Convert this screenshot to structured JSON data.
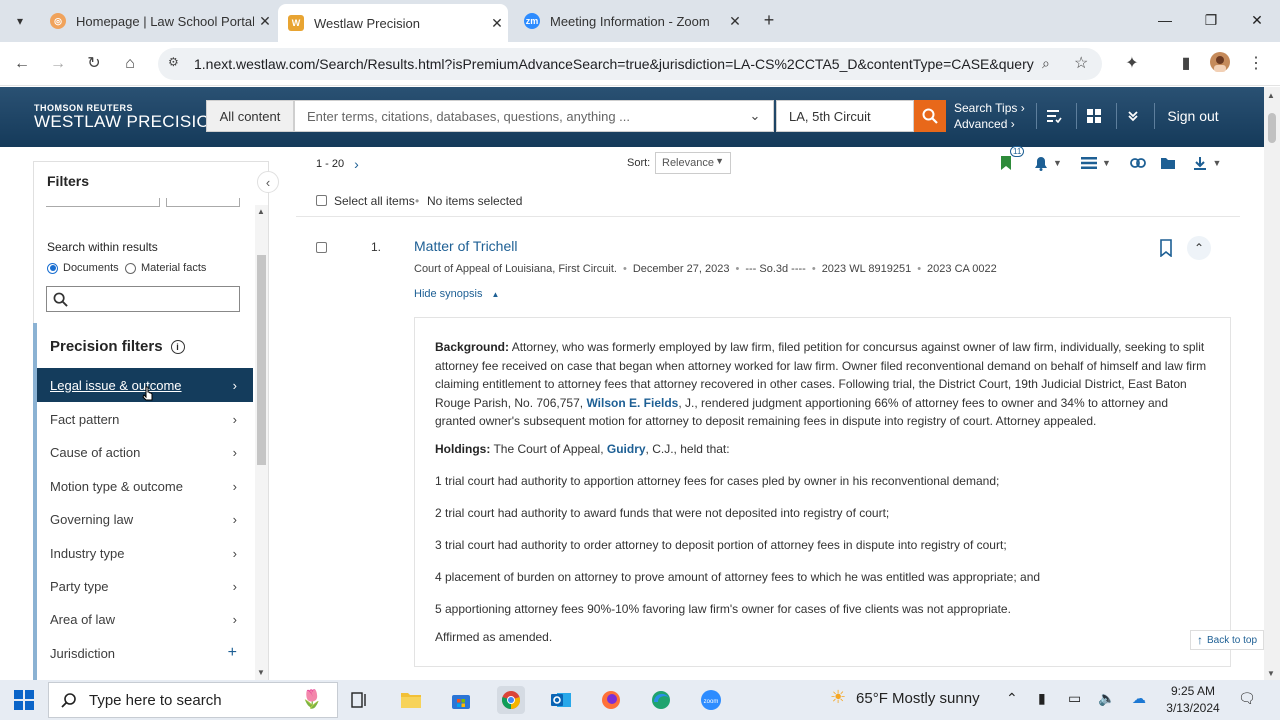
{
  "browser": {
    "tabs": [
      {
        "title": "Homepage | Law School Portal",
        "active": false
      },
      {
        "title": "Westlaw Precision",
        "active": true
      },
      {
        "title": "Meeting Information - Zoom",
        "active": false
      }
    ],
    "url": "1.next.westlaw.com/Search/Results.html?isPremiumAdvanceSearch=true&jurisdiction=LA-CS%2CCTA5_D&contentType=CASE&queryS..."
  },
  "header": {
    "brand_line1": "THOMSON REUTERS",
    "brand_line2": "WESTLAW PRECISION",
    "scope": "All content",
    "search_placeholder": "Enter terms, citations, databases, questions, anything ...",
    "jurisdiction": "LA, 5th Circuit",
    "search_tips": "Search Tips",
    "advanced": "Advanced",
    "sign_out": "Sign out"
  },
  "filters": {
    "title": "Filters",
    "search_within_label": "Search within results",
    "radio_documents": "Documents",
    "radio_material_facts": "Material facts",
    "precision_title": "Precision filters",
    "items": [
      {
        "label": "Legal issue & outcome",
        "active": true,
        "icon": "chevron-right"
      },
      {
        "label": "Fact pattern",
        "active": false,
        "icon": "chevron-right"
      },
      {
        "label": "Cause of action",
        "active": false,
        "icon": "chevron-right"
      },
      {
        "label": "Motion type & outcome",
        "active": false,
        "icon": "chevron-right"
      },
      {
        "label": "Governing law",
        "active": false,
        "icon": "chevron-right"
      },
      {
        "label": "Industry type",
        "active": false,
        "icon": "chevron-right"
      },
      {
        "label": "Party type",
        "active": false,
        "icon": "chevron-right"
      },
      {
        "label": "Area of law",
        "active": false,
        "icon": "chevron-right"
      },
      {
        "label": "Jurisdiction",
        "active": false,
        "icon": "plus"
      }
    ]
  },
  "results": {
    "range": "1 - 20",
    "sort_label": "Sort:",
    "sort_value": "Relevance",
    "folder_badge": "11",
    "select_all": "Select all items",
    "no_items": "No items selected",
    "item": {
      "number": "1.",
      "title": "Matter of Trichell",
      "court": "Court of Appeal of Louisiana, First Circuit.",
      "date": "December 27, 2023",
      "reporter": "--- So.3d ----",
      "wl_cite": "2023 WL 8919251",
      "docket": "2023 CA 0022",
      "hide_synopsis": "Hide synopsis",
      "background_label": "Background:",
      "background_part1": "Attorney, who was formerly employed by law firm, filed petition for concursus against owner of law firm, individually, seeking to split attorney fee received on case that began when attorney worked for law firm. Owner filed reconventional demand on behalf of himself and law firm claiming entitlement to attorney fees that attorney recovered in other cases. Following trial, the District Court, 19th Judicial District, East Baton Rouge Parish, No. 706,757,",
      "background_judge": "Wilson E. Fields",
      "background_part2": ", J., rendered judgment apportioning 66% of attorney fees to owner and 34% to attorney and granted owner's subsequent motion for attorney to deposit remaining fees in dispute into registry of court. Attorney appealed.",
      "holdings_label": "Holdings:",
      "holdings_part1": "The Court of Appeal,",
      "holdings_judge": "Guidry",
      "holdings_part2": ", C.J., held that:",
      "holdings": [
        "1 trial court had authority to apportion attorney fees for cases pled by owner in his reconventional demand;",
        "2 trial court had authority to award funds that were not deposited into registry of court;",
        "3 trial court had authority to order attorney to deposit portion of attorney fees in dispute into registry of court;",
        "4 placement of burden on attorney to prove amount of attorney fees to which he was entitled was appropriate; and",
        "5 apportioning attorney fees 90%-10% favoring law firm's owner for cases of five clients was not appropriate."
      ],
      "disposition": "Affirmed as amended."
    },
    "back_to_top": "Back to top"
  },
  "taskbar": {
    "search_placeholder": "Type here to search",
    "weather": "65°F  Mostly sunny",
    "time": "9:25 AM",
    "date": "3/13/2024"
  },
  "colors": {
    "header_blue": "#153a5a",
    "link_blue": "#1d5f94",
    "search_orange": "#e8681a",
    "active_filter_bg": "#143c5c"
  }
}
